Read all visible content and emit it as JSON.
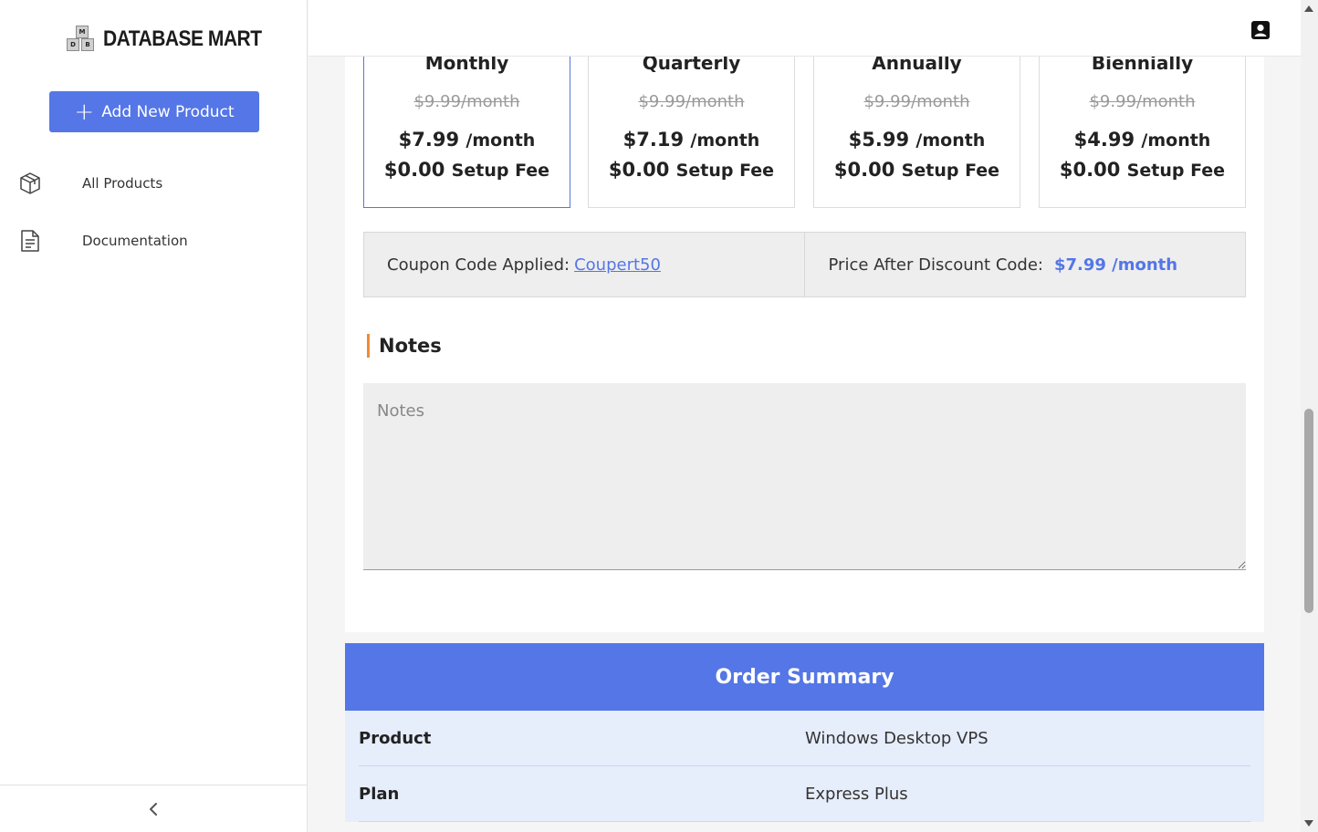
{
  "brand": {
    "logo_text": "DATABASE MART",
    "logo_letters": [
      "M",
      "D",
      "B"
    ]
  },
  "sidebar": {
    "add_button_label": "Add New Product",
    "items": [
      {
        "label": "All Products",
        "icon": "cube-icon"
      },
      {
        "label": "Documentation",
        "icon": "document-icon"
      }
    ],
    "collapse_icon": "chevron-left-icon"
  },
  "header": {
    "user_icon": "user-account-icon"
  },
  "billing_cycles": [
    {
      "name": "Monthly",
      "old_price": "$9.99/month",
      "price": "$7.99",
      "unit": "/month",
      "setup_amount": "$0.00",
      "setup_label": "Setup Fee",
      "selected": true
    },
    {
      "name": "Quarterly",
      "old_price": "$9.99/month",
      "price": "$7.19",
      "unit": "/month",
      "setup_amount": "$0.00",
      "setup_label": "Setup Fee",
      "selected": false
    },
    {
      "name": "Annually",
      "old_price": "$9.99/month",
      "price": "$5.99",
      "unit": "/month",
      "setup_amount": "$0.00",
      "setup_label": "Setup Fee",
      "selected": false
    },
    {
      "name": "Biennially",
      "old_price": "$9.99/month",
      "price": "$4.99",
      "unit": "/month",
      "setup_amount": "$0.00",
      "setup_label": "Setup Fee",
      "selected": false
    }
  ],
  "coupon": {
    "label": "Coupon Code Applied:",
    "code": "Coupert50",
    "discount_label": "Price After Discount Code:",
    "discount_price": "$7.99 /month"
  },
  "notes": {
    "title": "Notes",
    "placeholder": "Notes",
    "value": ""
  },
  "order_summary": {
    "title": "Order Summary",
    "rows": [
      {
        "key": "Product",
        "value": "Windows Desktop VPS"
      },
      {
        "key": "Plan",
        "value": "Express Plus"
      }
    ]
  },
  "colors": {
    "accent": "#5476e6",
    "notes_marker": "#f08a34",
    "summary_row_bg": "#e6edfb"
  }
}
